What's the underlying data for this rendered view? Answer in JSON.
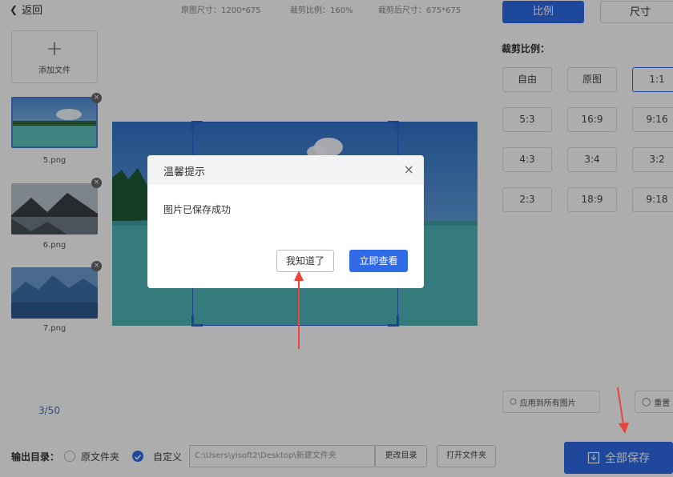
{
  "header": {
    "back_label": "返回",
    "original_size": "原图尺寸：1200*675",
    "crop_ratio": "裁剪比例：160%",
    "cropped_size": "裁剪后尺寸：675*675"
  },
  "sidebar": {
    "add_file_label": "添加文件",
    "files": [
      {
        "name": "5.png",
        "active": true
      },
      {
        "name": "6.png",
        "active": false
      },
      {
        "name": "7.png",
        "active": false
      }
    ],
    "page_count": "3/50"
  },
  "right_panel": {
    "tabs": [
      {
        "label": "比例",
        "active": true
      },
      {
        "label": "尺寸",
        "active": false
      }
    ],
    "section_title": "裁剪比例：",
    "ratios": [
      "自由",
      "原图",
      "1:1",
      "5:3",
      "16:9",
      "9:16",
      "4:3",
      "3:4",
      "3:2",
      "2:3",
      "18:9",
      "9:18"
    ],
    "selected_ratio": "1:1",
    "apply_all_label": "应用到所有图片",
    "reset_label": "重置",
    "save_all_label": "全部保存"
  },
  "bottom": {
    "output_label": "输出目录：",
    "original_folder_label": "原文件夹",
    "custom_label": "自定义",
    "custom_selected": true,
    "path_value": "C:\\Users\\yisoft2\\Desktop\\新建文件夹",
    "change_dir_label": "更改目录",
    "open_folder_label": "打开文件夹"
  },
  "dialog": {
    "title": "温馨提示",
    "message": "图片已保存成功",
    "ok_label": "我知道了",
    "view_label": "立即查看",
    "close_glyph": "×"
  },
  "colors": {
    "accent": "#2f6be6",
    "annotation_arrow": "#e8453c"
  }
}
